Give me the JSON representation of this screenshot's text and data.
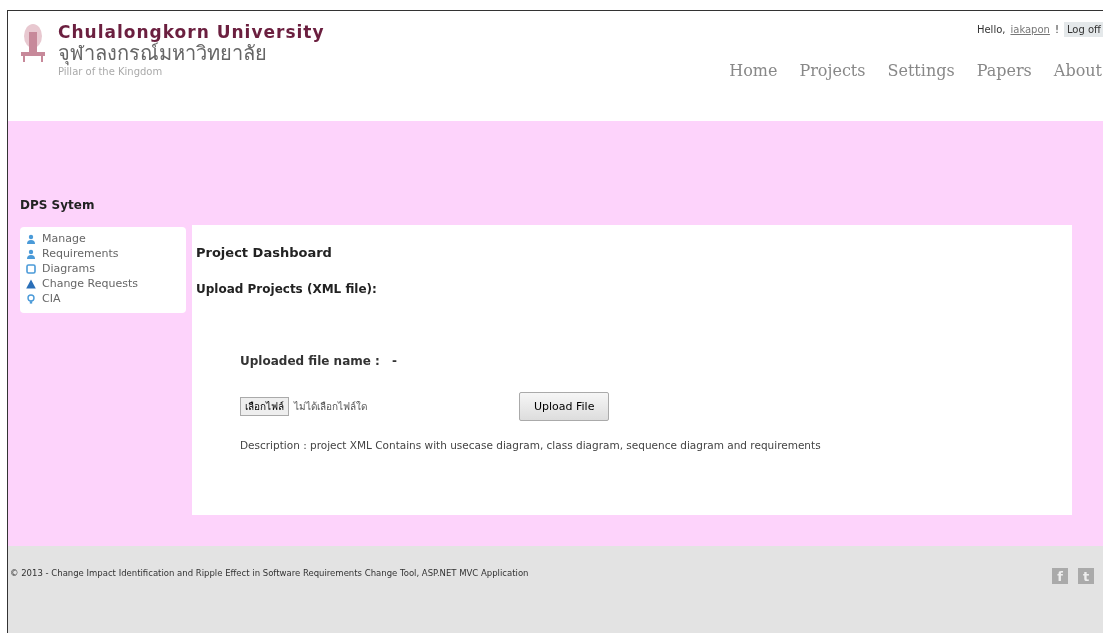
{
  "brand": {
    "name_en": "Chulalongkorn University",
    "name_th": "จุฬาลงกรณ์มหาวิทยาลัย",
    "tagline": "Pillar of the Kingdom"
  },
  "user": {
    "greeting": "Hello,",
    "username": "iakapon",
    "suffix": "!",
    "logoff": "Log off"
  },
  "nav": [
    {
      "label": "Home"
    },
    {
      "label": "Projects"
    },
    {
      "label": "Settings"
    },
    {
      "label": "Papers"
    },
    {
      "label": "About"
    }
  ],
  "sidebar": {
    "title": "DPS Sytem",
    "items": [
      {
        "label": "Manage",
        "kind": "user"
      },
      {
        "label": "Requirements",
        "kind": "user"
      },
      {
        "label": "Diagrams",
        "kind": "diagram"
      },
      {
        "label": "Change Requests",
        "kind": "warning"
      },
      {
        "label": "CIA",
        "kind": "bulb"
      }
    ]
  },
  "main": {
    "title": "Project Dashboard",
    "subtitle": "Upload Projects (XML file):",
    "file_label": "Uploaded file name :",
    "file_value": "-",
    "choose_button": "เลือกไฟล์",
    "no_file": "ไม่ได้เลือกไฟล์ใด",
    "upload_button": "Upload File",
    "description": "Description : project XML Contains with usecase diagram, class diagram, sequence diagram and requirements"
  },
  "footer": {
    "text": "© 2013 - Change Impact Identification and Ripple Effect in Software Requirements Change Tool, ASP.NET MVC Application",
    "social": [
      "f",
      "t"
    ]
  }
}
